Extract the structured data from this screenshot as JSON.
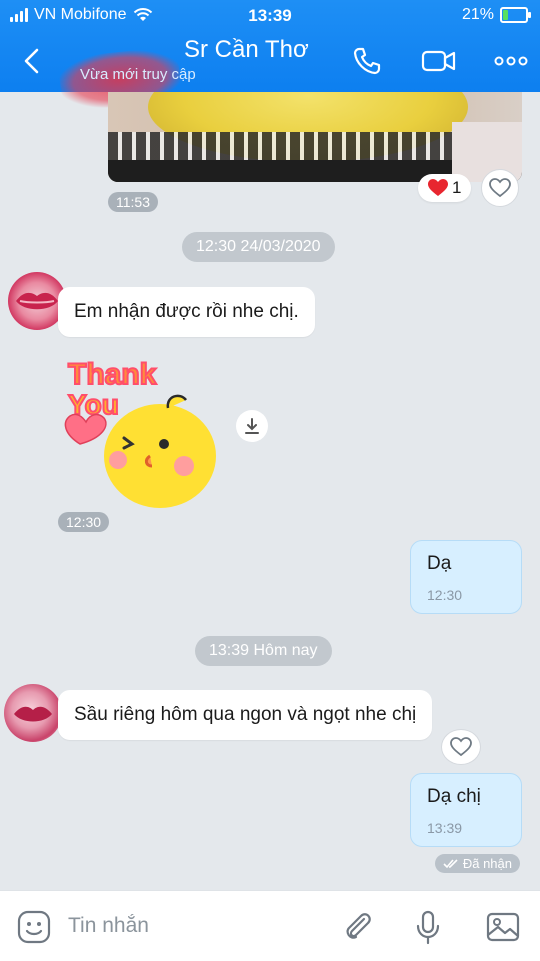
{
  "status_bar": {
    "carrier": "VN Mobifone",
    "time": "13:39",
    "battery_percent": "21%",
    "battery_level": 0.21
  },
  "header": {
    "title": "Sr Cần Thơ",
    "subtitle": "Vừa mới truy cập"
  },
  "messages": {
    "photo_time": "11:53",
    "photo_reaction_count": "1",
    "date_separator_1": "12:30 24/03/2020",
    "incoming_1_text": "Em nhận được rồi nhe chị.",
    "sticker_time": "12:30",
    "outgoing_1_text": "Dạ",
    "outgoing_1_time": "12:30",
    "date_separator_2": "13:39 Hôm nay",
    "incoming_2_text": "Sầu riêng hôm qua ngon và ngọt nhe chị",
    "outgoing_2_text": "Dạ chị",
    "outgoing_2_time": "13:39",
    "received_status": "Đã nhận"
  },
  "sticker": {
    "line1": "Thank",
    "line2": "You"
  },
  "input_bar": {
    "placeholder": "Tin nhắn"
  },
  "colors": {
    "header_blue": "#0d7ff0",
    "chat_background": "#e4e8ec",
    "outgoing_bubble": "#d7efff",
    "reaction_heart": "#e8262f"
  }
}
